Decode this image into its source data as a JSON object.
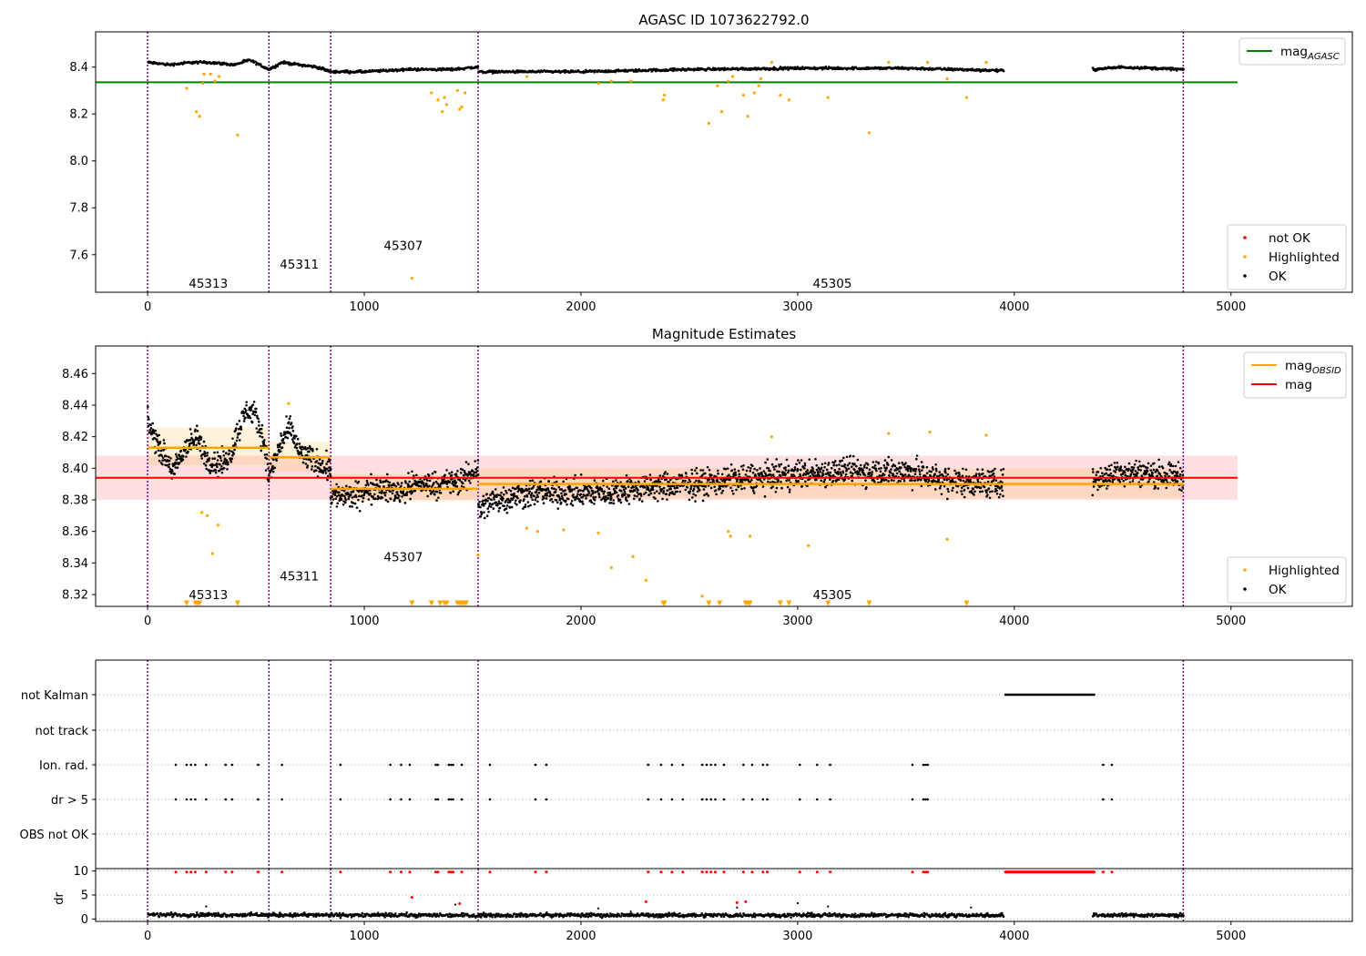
{
  "colors": {
    "ok": "#000000",
    "highlighted": "#ffa500",
    "not_ok": "#ff0000",
    "agasc_line": "#008000",
    "mag_line": "#ff0000",
    "mag_obsid_line": "#ffa500",
    "obs_boundary": "#800080",
    "mag_band": "#ff0000",
    "mag_obsid_band": "#ffa500"
  },
  "chart_data": [
    {
      "type": "scatter",
      "title": "AGASC ID 1073622792.0",
      "xlabel": "",
      "ylabel": "",
      "xlim": [
        -240,
        5560
      ],
      "ylim": [
        7.44,
        8.55
      ],
      "x_ticks": [
        0,
        1000,
        2000,
        3000,
        4000,
        5000
      ],
      "y_ticks": [
        7.6,
        7.8,
        8.0,
        8.2,
        8.4
      ],
      "x_tick_labels": [
        "0",
        "1000",
        "2000",
        "3000",
        "4000",
        "5000"
      ],
      "y_tick_labels": [
        "7.6",
        "7.8",
        "8.0",
        "8.2",
        "8.4"
      ],
      "grid": false,
      "legends": [
        {
          "placement": "top-right",
          "entries": [
            {
              "label": "mag",
              "subscript": "AGASC",
              "marker": "line",
              "color_key": "agasc_line"
            }
          ]
        },
        {
          "placement": "lower-right",
          "entries": [
            {
              "label": "not OK",
              "marker": "dot",
              "color_key": "not_ok"
            },
            {
              "label": "Highlighted",
              "marker": "dot",
              "color_key": "highlighted"
            },
            {
              "label": "OK",
              "marker": "dot",
              "color_key": "ok"
            }
          ]
        }
      ],
      "obs_boundaries": [
        0,
        560,
        845,
        1525,
        4780
      ],
      "obs_labels": [
        {
          "text": "45313",
          "x": 280,
          "y": 7.46
        },
        {
          "text": "45311",
          "x": 700,
          "y": 7.54
        },
        {
          "text": "45307",
          "x": 1180,
          "y": 7.62
        },
        {
          "text": "45305",
          "x": 3160,
          "y": 7.46
        }
      ],
      "reference_lines": [
        {
          "name": "mag_AGASC",
          "y": 8.335,
          "x_range": [
            -240,
            5030
          ]
        }
      ],
      "series": [
        {
          "name": "OK",
          "kind": "band",
          "segments": [
            {
              "x": [
                0,
                100,
                200,
                280,
                400,
                470,
                560,
                620,
                700,
                780,
                845,
                1000,
                1200,
                1400,
                1525
              ],
              "y": [
                8.42,
                8.41,
                8.42,
                8.42,
                8.41,
                8.43,
                8.39,
                8.42,
                8.41,
                8.4,
                8.38,
                8.38,
                8.39,
                8.39,
                8.4
              ],
              "spread": 0.008
            },
            {
              "x": [
                1525,
                2000,
                2500,
                3000,
                3500,
                3950
              ],
              "y": [
                8.38,
                8.38,
                8.39,
                8.395,
                8.395,
                8.385
              ],
              "spread": 0.008
            },
            {
              "x": [
                4360,
                4500,
                4780
              ],
              "y": [
                8.39,
                8.4,
                8.39
              ],
              "spread": 0.008
            }
          ]
        },
        {
          "name": "Highlighted",
          "kind": "points",
          "x": [
            180,
            225,
            240,
            255,
            260,
            290,
            310,
            330,
            415,
            1220,
            1310,
            1340,
            1360,
            1370,
            1380,
            1430,
            1440,
            1450,
            1465,
            1750,
            2080,
            2140,
            2230,
            2380,
            2385,
            2590,
            2630,
            2650,
            2680,
            2700,
            2750,
            2770,
            2800,
            2820,
            2830,
            2880,
            2920,
            2960,
            3140,
            3330,
            3420,
            3600,
            3690,
            3780,
            3870
          ],
          "y": [
            8.31,
            8.21,
            8.19,
            8.33,
            8.37,
            8.37,
            8.34,
            8.36,
            8.11,
            7.5,
            8.29,
            8.26,
            8.21,
            8.27,
            8.24,
            8.3,
            8.22,
            8.23,
            8.29,
            8.36,
            8.33,
            8.34,
            8.34,
            8.26,
            8.28,
            8.16,
            8.32,
            8.21,
            8.34,
            8.36,
            8.28,
            8.19,
            8.29,
            8.32,
            8.35,
            8.42,
            8.28,
            8.26,
            8.27,
            8.12,
            8.42,
            8.42,
            8.35,
            8.27,
            8.42
          ]
        }
      ]
    },
    {
      "type": "scatter",
      "title": "Magnitude Estimates",
      "xlabel": "",
      "ylabel": "",
      "xlim": [
        -240,
        5560
      ],
      "ylim": [
        8.3125,
        8.4775
      ],
      "x_ticks": [
        0,
        1000,
        2000,
        3000,
        4000,
        5000
      ],
      "y_ticks": [
        8.32,
        8.34,
        8.36,
        8.38,
        8.4,
        8.42,
        8.44,
        8.46
      ],
      "x_tick_labels": [
        "0",
        "1000",
        "2000",
        "3000",
        "4000",
        "5000"
      ],
      "y_tick_labels": [
        "8.32",
        "8.34",
        "8.36",
        "8.38",
        "8.40",
        "8.42",
        "8.44",
        "8.46"
      ],
      "grid": false,
      "legends": [
        {
          "placement": "top-right",
          "entries": [
            {
              "label": "mag",
              "subscript": "OBSID",
              "marker": "line",
              "color_key": "mag_obsid_line"
            },
            {
              "label": "mag",
              "marker": "line",
              "color_key": "mag_line"
            }
          ]
        },
        {
          "placement": "lower-right",
          "entries": [
            {
              "label": "Highlighted",
              "marker": "dot",
              "color_key": "highlighted"
            },
            {
              "label": "OK",
              "marker": "dot",
              "color_key": "ok"
            }
          ]
        }
      ],
      "obs_boundaries": [
        0,
        560,
        845,
        1525,
        4780
      ],
      "obs_labels": [
        {
          "text": "45313",
          "x": 280,
          "y": 8.317
        },
        {
          "text": "45311",
          "x": 700,
          "y": 8.329
        },
        {
          "text": "45307",
          "x": 1180,
          "y": 8.341
        },
        {
          "text": "45305",
          "x": 3160,
          "y": 8.317
        }
      ],
      "mag": {
        "value": 8.394,
        "band": [
          8.38,
          8.408
        ],
        "x_range": [
          -240,
          5030
        ]
      },
      "mag_obsid": [
        {
          "x_range": [
            0,
            560
          ],
          "value": 8.413,
          "band": [
            8.402,
            8.426
          ]
        },
        {
          "x_range": [
            560,
            845
          ],
          "value": 8.407,
          "band": [
            8.398,
            8.417
          ]
        },
        {
          "x_range": [
            845,
            1525
          ],
          "value": 8.387,
          "band": [
            8.379,
            8.396
          ]
        },
        {
          "x_range": [
            1525,
            4780
          ],
          "value": 8.39,
          "band": [
            8.381,
            8.4
          ]
        }
      ],
      "series": [
        {
          "name": "OK",
          "kind": "band",
          "segments": [
            {
              "x": [
                0,
                60,
                120,
                180,
                230,
                280,
                330,
                380,
                420,
                460,
                500,
                540,
                560
              ],
              "y": [
                8.428,
                8.412,
                8.398,
                8.415,
                8.418,
                8.405,
                8.402,
                8.408,
                8.425,
                8.438,
                8.432,
                8.415,
                8.392
              ],
              "spread": 0.012
            },
            {
              "x": [
                560,
                620,
                660,
                700,
                760,
                845
              ],
              "y": [
                8.395,
                8.418,
                8.425,
                8.41,
                8.405,
                8.4
              ],
              "spread": 0.012
            },
            {
              "x": [
                845,
                950,
                1050,
                1150,
                1250,
                1350,
                1450,
                1525
              ],
              "y": [
                8.383,
                8.382,
                8.388,
                8.385,
                8.39,
                8.39,
                8.392,
                8.4
              ],
              "spread": 0.012
            },
            {
              "x": [
                1525,
                1600,
                1800,
                2000,
                2200,
                2500,
                2800,
                3000,
                3200,
                3500,
                3700,
                3950
              ],
              "y": [
                8.374,
                8.38,
                8.385,
                8.384,
                8.386,
                8.39,
                8.394,
                8.396,
                8.398,
                8.398,
                8.392,
                8.39
              ],
              "spread": 0.013
            },
            {
              "x": [
                4360,
                4500,
                4780
              ],
              "y": [
                8.392,
                8.398,
                8.395
              ],
              "spread": 0.012
            }
          ]
        },
        {
          "name": "Highlighted",
          "kind": "points",
          "x": [
            250,
            275,
            325,
            300,
            650,
            1525,
            1750,
            1800,
            1920,
            2080,
            2140,
            2240,
            2300,
            2560,
            2680,
            2690,
            2780,
            2880,
            3050,
            3420,
            3610,
            3690,
            3870
          ],
          "y": [
            8.372,
            8.37,
            8.364,
            8.346,
            8.441,
            8.345,
            8.362,
            8.36,
            8.361,
            8.359,
            8.337,
            8.344,
            8.329,
            8.319,
            8.36,
            8.357,
            8.357,
            8.42,
            8.351,
            8.422,
            8.423,
            8.355,
            8.421
          ]
        },
        {
          "name": "Highlighted (below axis)",
          "kind": "triangles",
          "x": [
            180,
            220,
            230,
            240,
            415,
            1220,
            1310,
            1350,
            1370,
            1380,
            1430,
            1440,
            1450,
            1460,
            1470,
            2380,
            2385,
            2590,
            2640,
            2760,
            2770,
            2780,
            2920,
            2960,
            3140,
            3330,
            3780
          ],
          "y": [
            8.3145,
            8.3145,
            8.3145,
            8.3145,
            8.3145,
            8.3145,
            8.3145,
            8.3145,
            8.3145,
            8.3145,
            8.3145,
            8.3145,
            8.3145,
            8.3145,
            8.3145,
            8.3145,
            8.3145,
            8.3145,
            8.3145,
            8.3145,
            8.3145,
            8.3145,
            8.3145,
            8.3145,
            8.3145,
            8.3145,
            8.3145
          ]
        }
      ]
    },
    {
      "type": "scatter",
      "title": "",
      "xlabel": "",
      "ylabel": "",
      "xlim": [
        -240,
        5560
      ],
      "categories": [
        "not Kalman",
        "not track",
        "Ion. rad.",
        "dr > 5",
        "OBS not OK"
      ],
      "grid": "dotted horizontal lines at each flag row",
      "obs_boundaries": [
        0,
        560,
        845,
        1525,
        4780
      ],
      "flags": [
        {
          "name": "not Kalman",
          "ranges": [
            [
              3960,
              4370
            ]
          ],
          "x": []
        },
        {
          "name": "not track",
          "x": []
        },
        {
          "name": "Ion. rad.",
          "x": [
            130,
            180,
            200,
            220,
            270,
            360,
            390,
            510,
            620,
            890,
            1120,
            1170,
            1210,
            1330,
            1340,
            1390,
            1400,
            1410,
            1450,
            1580,
            1790,
            1840,
            2310,
            2370,
            2420,
            2470,
            2560,
            2580,
            2600,
            2620,
            2660,
            2750,
            2790,
            2840,
            2860,
            3010,
            3090,
            3150,
            3530,
            3580,
            3590,
            3600,
            4410,
            4450
          ]
        },
        {
          "name": "dr > 5",
          "x": [
            130,
            180,
            200,
            220,
            270,
            360,
            390,
            510,
            620,
            890,
            1120,
            1170,
            1210,
            1330,
            1340,
            1390,
            1400,
            1410,
            1450,
            1580,
            1790,
            1840,
            2310,
            2370,
            2420,
            2470,
            2560,
            2580,
            2600,
            2620,
            2660,
            2750,
            2790,
            2840,
            2860,
            3010,
            3090,
            3150,
            3530,
            3580,
            3590,
            3600,
            4410,
            4450
          ]
        },
        {
          "name": "OBS not OK",
          "x": []
        }
      ]
    },
    {
      "type": "scatter",
      "title": "",
      "xlabel": "",
      "ylabel": "dr",
      "xlim": [
        -240,
        5560
      ],
      "ylim": [
        -0.5,
        10.5
      ],
      "x_ticks": [
        0,
        1000,
        2000,
        3000,
        4000,
        5000
      ],
      "y_ticks": [
        0,
        5,
        10
      ],
      "x_tick_labels": [
        "0",
        "1000",
        "2000",
        "3000",
        "4000",
        "5000"
      ],
      "y_tick_labels": [
        "0",
        "5",
        "10"
      ],
      "grid": "dotted horizontal lines at 0, 5, 10",
      "obs_boundaries": [
        0,
        560,
        845,
        1525,
        4780
      ],
      "series": [
        {
          "name": "OK",
          "kind": "band",
          "segments": [
            {
              "x": [
                0,
                1000,
                2000,
                3000,
                3950
              ],
              "y": [
                0.9,
                0.8,
                0.8,
                0.8,
                0.8
              ],
              "spread": 0.6
            },
            {
              "x": [
                4360,
                4780
              ],
              "y": [
                0.8,
                0.8
              ],
              "spread": 0.6
            }
          ]
        },
        {
          "name": "not OK",
          "kind": "points",
          "x": [
            130,
            180,
            200,
            220,
            270,
            360,
            390,
            510,
            620,
            890,
            1120,
            1170,
            1210,
            1220,
            1330,
            1340,
            1390,
            1400,
            1410,
            1440,
            1450,
            1580,
            1790,
            1840,
            2300,
            2310,
            2370,
            2420,
            2470,
            2560,
            2580,
            2600,
            2620,
            2660,
            2720,
            2750,
            2760,
            2790,
            2840,
            2860,
            3010,
            3090,
            3150,
            3530,
            3580,
            3590,
            3600,
            4410,
            4450
          ],
          "y": [
            9.8,
            9.8,
            9.8,
            9.8,
            9.8,
            9.8,
            9.8,
            9.8,
            9.8,
            9.8,
            9.8,
            9.8,
            9.8,
            4.5,
            9.8,
            9.8,
            9.8,
            9.8,
            9.8,
            3.2,
            9.8,
            9.8,
            9.8,
            9.8,
            3.6,
            9.8,
            9.8,
            9.8,
            9.8,
            9.8,
            9.8,
            9.8,
            9.8,
            9.8,
            3.4,
            9.8,
            3.6,
            9.8,
            9.8,
            9.8,
            9.8,
            9.8,
            9.8,
            9.8,
            9.8,
            9.8,
            9.8,
            9.8,
            9.8
          ]
        },
        {
          "name": "not OK (clipped)",
          "kind": "range",
          "x_range": [
            3960,
            4370
          ],
          "y": 9.8
        },
        {
          "name": "OK outliers",
          "kind": "points",
          "x": [
            270,
            1420,
            2080,
            2230,
            2720,
            3000,
            3140,
            3800
          ],
          "y": [
            2.6,
            3.0,
            2.2,
            1.6,
            2.4,
            3.3,
            2.6,
            2.4
          ]
        }
      ]
    }
  ]
}
